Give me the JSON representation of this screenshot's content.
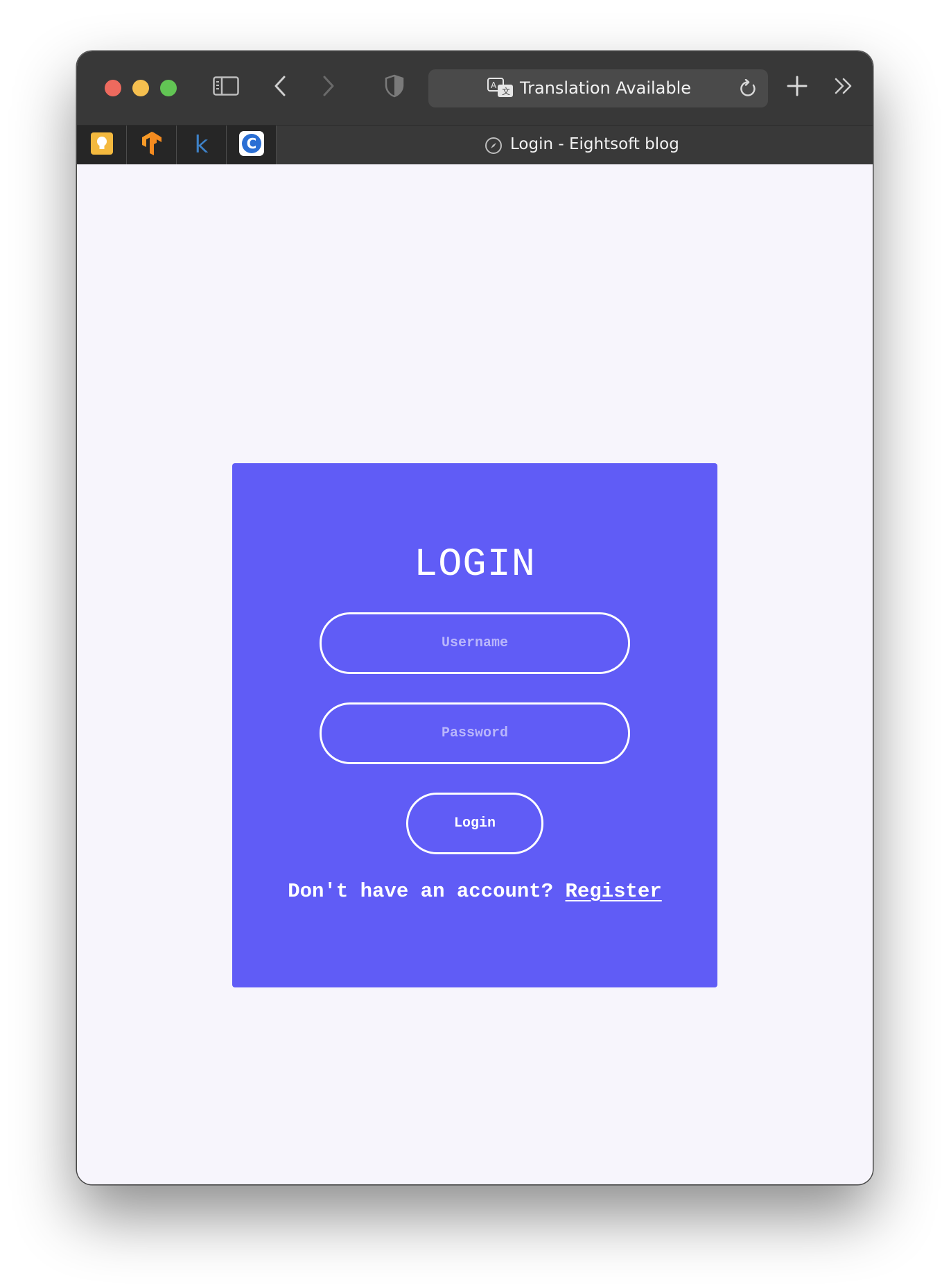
{
  "browser": {
    "address_bar": {
      "text": "Translation Available"
    },
    "pinned_tabs": [
      {
        "icon": "lightbulb-icon",
        "color": "#f4b93e"
      },
      {
        "icon": "tensorflow-icon",
        "color": "#f58b1f"
      },
      {
        "icon": "k-letter-icon",
        "text": "k",
        "color": "#3e82c8"
      },
      {
        "icon": "c-circle-icon",
        "text": "C",
        "color": "#2b6fd4"
      }
    ],
    "active_tab": {
      "title": "Login - Eightsoft blog"
    }
  },
  "page": {
    "background": "#f7f5fc",
    "card": {
      "color": "#605cf6",
      "title": "LOGIN",
      "username_placeholder": "Username",
      "password_placeholder": "Password",
      "login_button": "Login",
      "register_prompt": "Don't have an account?",
      "register_link": "Register"
    }
  }
}
